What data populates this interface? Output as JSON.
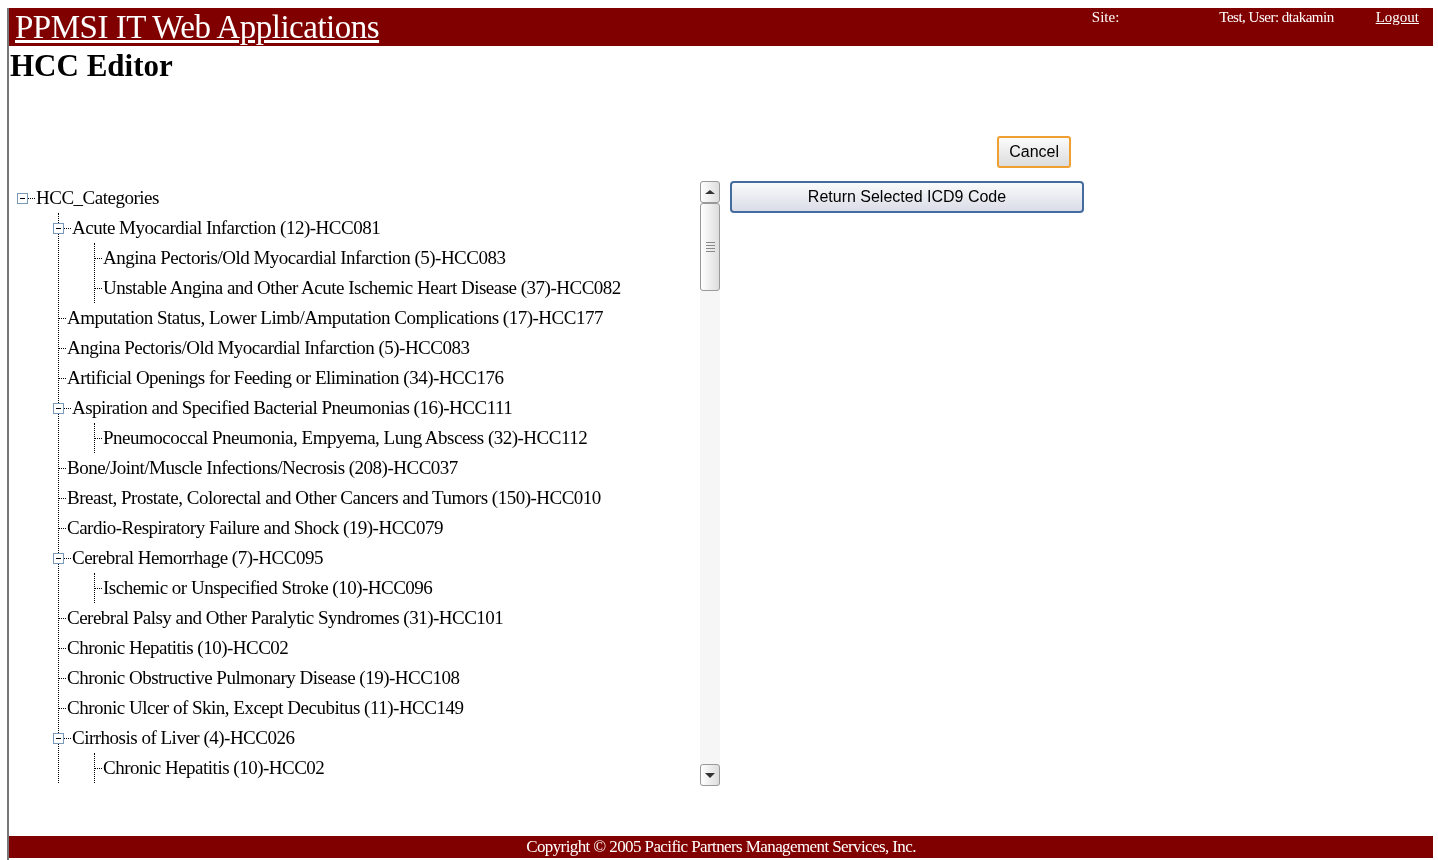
{
  "header": {
    "title": "PPMSI IT Web Applications",
    "site_label": "Site:",
    "user": "Test, User: dtakamin",
    "logout": "Logout"
  },
  "page_title": "HCC Editor",
  "buttons": {
    "cancel": "Cancel",
    "return_selected": "Return Selected ICD9 Code"
  },
  "tree": {
    "label": "HCC_Categories",
    "expanded": true,
    "children": [
      {
        "label": "Acute Myocardial Infarction (12)-HCC081",
        "expanded": true,
        "children": [
          {
            "label": "Angina Pectoris/Old Myocardial Infarction (5)-HCC083"
          },
          {
            "label": "Unstable Angina and Other Acute Ischemic Heart Disease (37)-HCC082"
          }
        ]
      },
      {
        "label": "Amputation Status, Lower Limb/Amputation Complications (17)-HCC177"
      },
      {
        "label": "Angina Pectoris/Old Myocardial Infarction (5)-HCC083"
      },
      {
        "label": "Artificial Openings for Feeding or Elimination (34)-HCC176"
      },
      {
        "label": "Aspiration and Specified Bacterial Pneumonias (16)-HCC111",
        "expanded": true,
        "children": [
          {
            "label": "Pneumococcal Pneumonia, Empyema, Lung Abscess (32)-HCC112"
          }
        ]
      },
      {
        "label": "Bone/Joint/Muscle Infections/Necrosis (208)-HCC037"
      },
      {
        "label": "Breast, Prostate, Colorectal and Other Cancers and Tumors (150)-HCC010"
      },
      {
        "label": "Cardio-Respiratory Failure and Shock (19)-HCC079"
      },
      {
        "label": "Cerebral Hemorrhage (7)-HCC095",
        "expanded": true,
        "children": [
          {
            "label": "Ischemic or Unspecified Stroke (10)-HCC096"
          }
        ]
      },
      {
        "label": "Cerebral Palsy and Other Paralytic Syndromes (31)-HCC101"
      },
      {
        "label": "Chronic Hepatitis (10)-HCC02"
      },
      {
        "label": "Chronic Obstructive Pulmonary Disease (19)-HCC108"
      },
      {
        "label": "Chronic Ulcer of Skin, Except Decubitus (11)-HCC149"
      },
      {
        "label": "Cirrhosis of Liver (4)-HCC026",
        "expanded": true,
        "children": [
          {
            "label": "Chronic Hepatitis (10)-HCC02"
          }
        ]
      }
    ]
  },
  "footer": "Copyright © 2005 Pacific Partners Management Services, Inc."
}
